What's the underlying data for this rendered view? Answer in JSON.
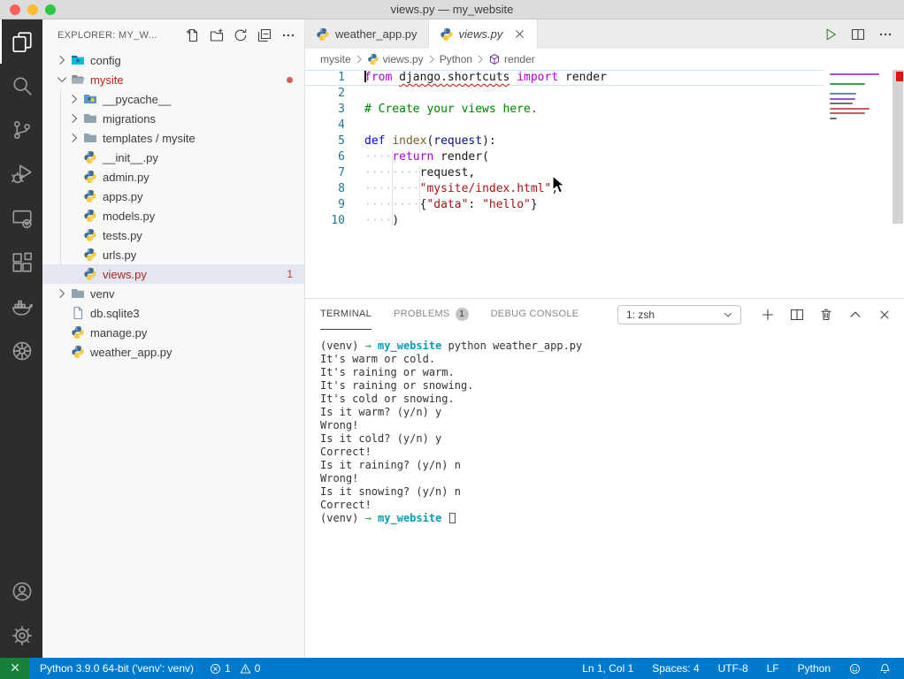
{
  "window": {
    "title": "views.py — my_website"
  },
  "colors": {
    "accent": "#007acc",
    "remote_green": "#188038",
    "error_red": "#e51400",
    "traffic_red": "#ff5f57",
    "traffic_yellow": "#febc2e",
    "traffic_green": "#28c840",
    "selection_bg": "#e4e6f1",
    "tree_error_fg": "#b3261e"
  },
  "activity_bar": {
    "items": [
      {
        "id": "explorer",
        "active": true
      },
      {
        "id": "search"
      },
      {
        "id": "source-control"
      },
      {
        "id": "run-debug"
      },
      {
        "id": "remote-explorer"
      },
      {
        "id": "extensions"
      },
      {
        "id": "docker"
      },
      {
        "id": "kubernetes"
      },
      {
        "id": "account",
        "bottom": true
      },
      {
        "id": "settings",
        "bottom": true
      }
    ]
  },
  "sidebar": {
    "header": {
      "title": "EXPLORER: MY_W...",
      "actions": [
        {
          "id": "new-file"
        },
        {
          "id": "new-folder"
        },
        {
          "id": "refresh"
        },
        {
          "id": "collapse-all"
        },
        {
          "id": "more"
        }
      ]
    },
    "tree": [
      {
        "label": "config",
        "icon": "folder-config",
        "depth": 0,
        "chevron": "right"
      },
      {
        "label": "mysite",
        "icon": "folder-open",
        "depth": 0,
        "chevron": "down",
        "error": true,
        "dot": true
      },
      {
        "label": "__pycache__",
        "icon": "folder-python",
        "depth": 1,
        "chevron": "right"
      },
      {
        "label": "migrations",
        "icon": "folder",
        "depth": 1,
        "chevron": "right"
      },
      {
        "label": "templates / mysite",
        "icon": "folder",
        "depth": 1,
        "chevron": "right"
      },
      {
        "label": "__init__.py",
        "icon": "python",
        "depth": 1
      },
      {
        "label": "admin.py",
        "icon": "python",
        "depth": 1
      },
      {
        "label": "apps.py",
        "icon": "python",
        "depth": 1
      },
      {
        "label": "models.py",
        "icon": "python",
        "depth": 1
      },
      {
        "label": "tests.py",
        "icon": "python",
        "depth": 1
      },
      {
        "label": "urls.py",
        "icon": "python",
        "depth": 1
      },
      {
        "label": "views.py",
        "icon": "python",
        "depth": 1,
        "selected": true,
        "error": true,
        "badge": "1"
      },
      {
        "label": "venv",
        "icon": "folder",
        "depth": 0,
        "chevron": "right"
      },
      {
        "label": "db.sqlite3",
        "icon": "file",
        "depth": 0
      },
      {
        "label": "manage.py",
        "icon": "python",
        "depth": 0
      },
      {
        "label": "weather_app.py",
        "icon": "python",
        "depth": 0
      }
    ]
  },
  "editor": {
    "tabs": [
      {
        "label": "weather_app.py",
        "icon": "python",
        "active": false
      },
      {
        "label": "views.py",
        "icon": "python",
        "active": true,
        "preview": true,
        "close": true
      }
    ],
    "actions": [
      {
        "id": "run"
      },
      {
        "id": "split-editor"
      },
      {
        "id": "more"
      }
    ],
    "breadcrumbs": [
      {
        "label": "mysite"
      },
      {
        "label": "views.py",
        "icon": "python"
      },
      {
        "label": "Python"
      },
      {
        "label": "render",
        "icon": "symbol-render"
      }
    ],
    "code": {
      "lines": [
        {
          "num": "1",
          "current": true,
          "caret": true,
          "tokens": [
            {
              "t": "from",
              "c": "k"
            },
            {
              "t": " ",
              "c": "p"
            },
            {
              "t": "django.shortcuts",
              "c": "p",
              "squiggle": true
            },
            {
              "t": " ",
              "c": "p"
            },
            {
              "t": "import",
              "c": "k"
            },
            {
              "t": " render",
              "c": "p"
            }
          ]
        },
        {
          "num": "2",
          "tokens": []
        },
        {
          "num": "3",
          "tokens": [
            {
              "t": "# Create your views here.",
              "c": "c"
            }
          ]
        },
        {
          "num": "4",
          "tokens": []
        },
        {
          "num": "5",
          "tokens": [
            {
              "t": "def",
              "c": "kb"
            },
            {
              "t": " ",
              "c": "p"
            },
            {
              "t": "index",
              "c": "f"
            },
            {
              "t": "(",
              "c": "p"
            },
            {
              "t": "request",
              "c": "pr"
            },
            {
              "t": "):",
              "c": "p"
            }
          ]
        },
        {
          "num": "6",
          "tokens": [
            {
              "t": "····",
              "c": "w"
            },
            {
              "t": "return",
              "c": "k"
            },
            {
              "t": " render(",
              "c": "p"
            }
          ]
        },
        {
          "num": "7",
          "tokens": [
            {
              "t": "········",
              "c": "w"
            },
            {
              "t": "request,",
              "c": "p"
            }
          ]
        },
        {
          "num": "8",
          "tokens": [
            {
              "t": "········",
              "c": "w"
            },
            {
              "t": "\"mysite/index.html\"",
              "c": "s"
            },
            {
              "t": ",",
              "c": "p"
            }
          ]
        },
        {
          "num": "9",
          "tokens": [
            {
              "t": "········",
              "c": "w"
            },
            {
              "t": "{",
              "c": "p"
            },
            {
              "t": "\"data\"",
              "c": "s"
            },
            {
              "t": ": ",
              "c": "p"
            },
            {
              "t": "\"hello\"",
              "c": "s"
            },
            {
              "t": "}",
              "c": "p"
            }
          ]
        },
        {
          "num": "10",
          "tokens": [
            {
              "t": "····",
              "c": "w"
            },
            {
              "t": ")",
              "c": "p"
            }
          ]
        }
      ]
    }
  },
  "panel": {
    "tabs": [
      {
        "label": "TERMINAL",
        "active": true
      },
      {
        "label": "PROBLEMS",
        "badge": "1"
      },
      {
        "label": "DEBUG CONSOLE"
      }
    ],
    "shell_label": "1: zsh",
    "actions": [
      {
        "id": "new-terminal"
      },
      {
        "id": "split-terminal"
      },
      {
        "id": "kill-terminal"
      },
      {
        "id": "maximize-panel"
      },
      {
        "id": "close-panel"
      }
    ],
    "terminal_lines": [
      {
        "tokens": [
          {
            "t": "(venv) ",
            "c": "d"
          },
          {
            "t": "→",
            "c": "g"
          },
          {
            "t": "  ",
            "c": "d"
          },
          {
            "t": "my_website",
            "c": "b"
          },
          {
            "t": " python weather_app.py",
            "c": "d"
          }
        ]
      },
      {
        "tokens": [
          {
            "t": "It's warm or cold.",
            "c": "d"
          }
        ]
      },
      {
        "tokens": [
          {
            "t": "It's raining or warm.",
            "c": "d"
          }
        ]
      },
      {
        "tokens": [
          {
            "t": "It's raining or snowing.",
            "c": "d"
          }
        ]
      },
      {
        "tokens": [
          {
            "t": "It's cold or snowing.",
            "c": "d"
          }
        ]
      },
      {
        "tokens": [
          {
            "t": "Is it warm? (y/n) y",
            "c": "d"
          }
        ]
      },
      {
        "tokens": [
          {
            "t": "Wrong!",
            "c": "d"
          }
        ]
      },
      {
        "tokens": [
          {
            "t": "Is it cold? (y/n) y",
            "c": "d"
          }
        ]
      },
      {
        "tokens": [
          {
            "t": "Correct!",
            "c": "d"
          }
        ]
      },
      {
        "tokens": [
          {
            "t": "Is it raining? (y/n) n",
            "c": "d"
          }
        ]
      },
      {
        "tokens": [
          {
            "t": "Wrong!",
            "c": "d"
          }
        ]
      },
      {
        "tokens": [
          {
            "t": "Is it snowing? (y/n) n",
            "c": "d"
          }
        ]
      },
      {
        "tokens": [
          {
            "t": "Correct!",
            "c": "d"
          }
        ]
      },
      {
        "cursor": true,
        "tokens": [
          {
            "t": "(venv) ",
            "c": "d"
          },
          {
            "t": "→",
            "c": "g"
          },
          {
            "t": "  ",
            "c": "d"
          },
          {
            "t": "my_website",
            "c": "b"
          },
          {
            "t": " ",
            "c": "d"
          }
        ]
      }
    ]
  },
  "status_bar": {
    "left": [
      {
        "id": "interpreter",
        "label": "Python 3.9.0 64-bit ('venv': venv)"
      },
      {
        "id": "problems",
        "errors": "1",
        "warnings": "0"
      }
    ],
    "right": [
      {
        "id": "cursor-position",
        "label": "Ln 1, Col 1"
      },
      {
        "id": "indentation",
        "label": "Spaces: 4"
      },
      {
        "id": "encoding",
        "label": "UTF-8"
      },
      {
        "id": "eol",
        "label": "LF"
      },
      {
        "id": "language",
        "label": "Python"
      },
      {
        "id": "feedback",
        "icon": "feedback"
      },
      {
        "id": "notifications",
        "icon": "bell"
      }
    ]
  }
}
